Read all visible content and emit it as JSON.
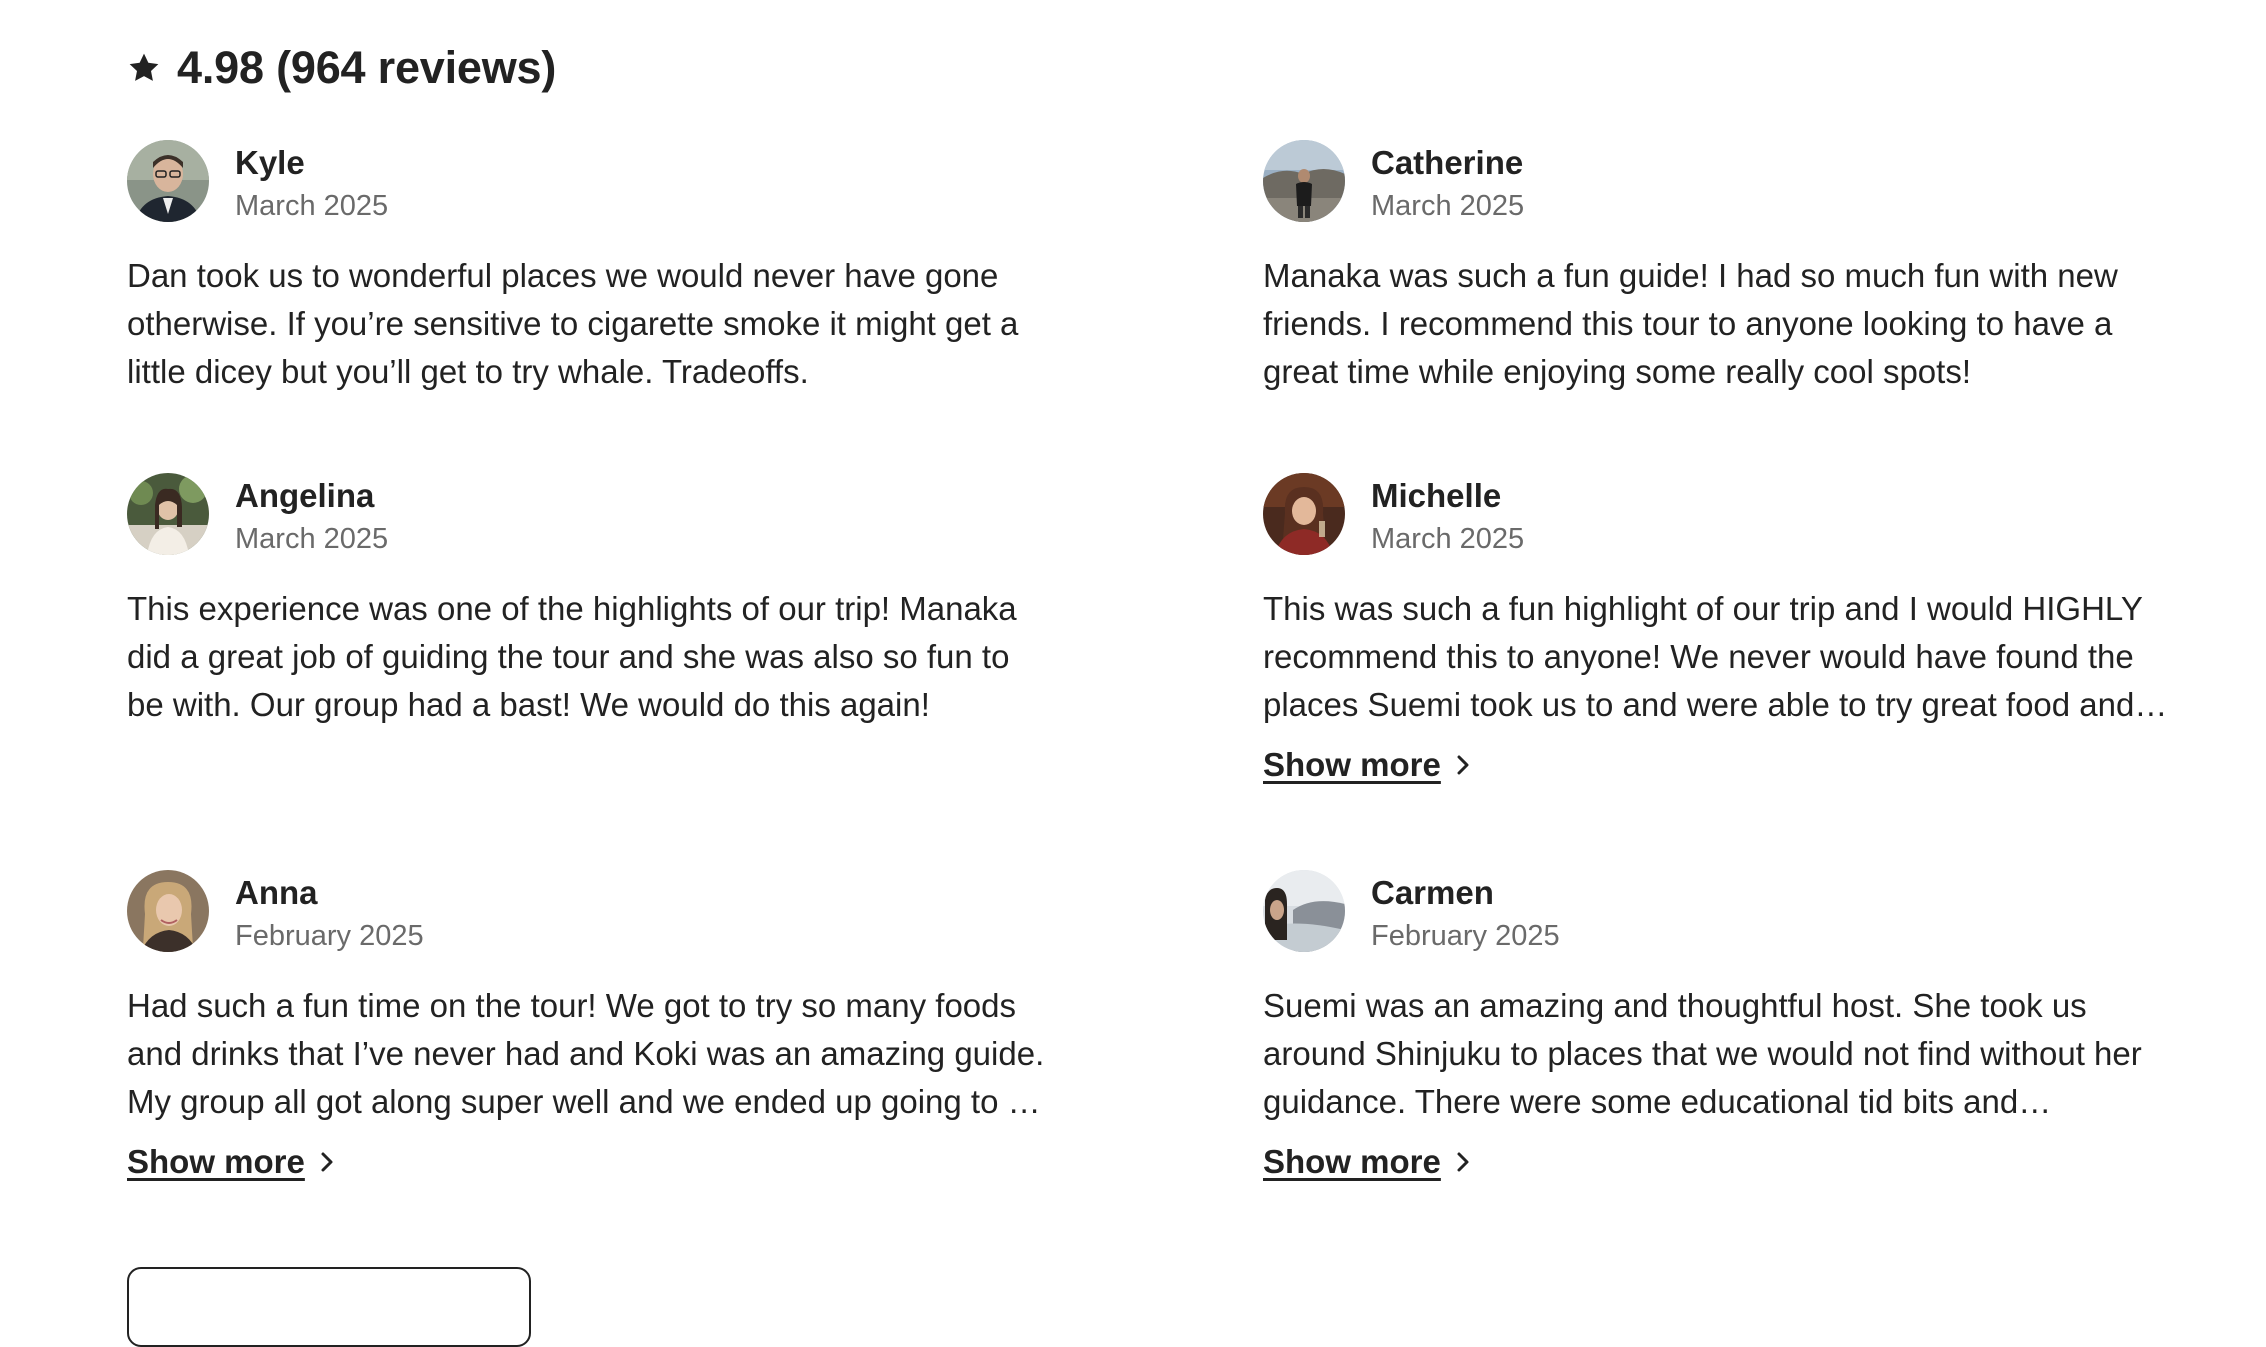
{
  "summary": {
    "rating_text": "4.98 (964 reviews)",
    "icon": "star-icon"
  },
  "reviews": [
    {
      "name": "Kyle",
      "date": "March 2025",
      "text": "Dan took us to wonderful places we would never have gone otherwise. If you’re sensitive to cigarette smoke it might get a little dicey but you’ll get to try whale. Tradeoffs.",
      "show_more": null
    },
    {
      "name": "Catherine",
      "date": "March 2025",
      "text": "Manaka was such a fun guide! I had so much fun with new friends. I recommend this tour to anyone looking to have a great time while enjoying some really cool spots!",
      "show_more": null
    },
    {
      "name": "Angelina",
      "date": "March 2025",
      "text": "This experience was one of the highlights of our trip! Manaka did a great job of guiding the tour and she was also so fun to be with. Our group had a bast! We would do this again!",
      "show_more": null
    },
    {
      "name": "Michelle",
      "date": "March 2025",
      "text": "This was such a fun highlight of our trip and I would HIGHLY recommend this to anyone! We never would have found the places Suemi took us to and were able to try great food and…",
      "show_more": "Show more"
    },
    {
      "name": "Anna",
      "date": "February 2025",
      "text": "Had such a fun time on the tour! We got to try so many foods and drinks that I’ve never had and Koki was an amazing guide. My group all got along super well and we ended up going to …",
      "show_more": "Show more"
    },
    {
      "name": "Carmen",
      "date": "February 2025",
      "text": "Suemi was an amazing and thoughtful host. She took us around Shinjuku to places that we would not find without her guidance. There were some educational tid bits and…",
      "show_more": "Show more"
    }
  ],
  "colors": {
    "text": "#222222",
    "muted": "#6a6a6a",
    "border": "#222222"
  }
}
